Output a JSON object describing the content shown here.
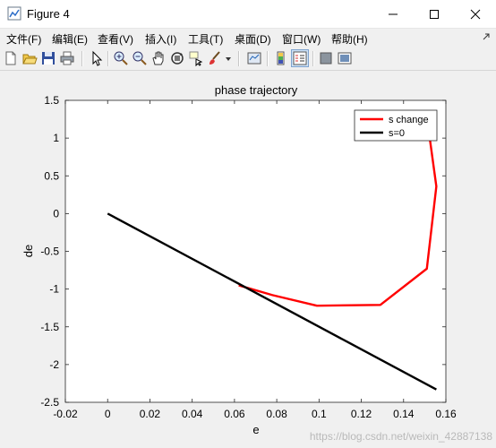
{
  "window": {
    "title": "Figure 4"
  },
  "menu": [
    "文件(F)",
    "编辑(E)",
    "查看(V)",
    "插入(I)",
    "工具(T)",
    "桌面(D)",
    "窗口(W)",
    "帮助(H)"
  ],
  "toolbar": {
    "icons": [
      "new-figure-icon",
      "open-file-icon",
      "save-icon",
      "print-icon",
      "edit-plot-arrow-icon",
      "zoom-in-icon",
      "zoom-out-icon",
      "pan-hand-icon",
      "rotate-3d-icon",
      "data-cursor-icon",
      "brush-icon",
      "brush-dropdown-icon",
      "link-plot-icon",
      "colorbar-icon",
      "legend-icon",
      "hide-plot-tools-icon",
      "show-plot-tools-icon"
    ]
  },
  "colors": {
    "s_change": "#ff0000",
    "s0": "#000000",
    "axes_bg": "#ffffff"
  },
  "chart_data": {
    "type": "line",
    "title": "phase trajectory",
    "xlabel": "e",
    "ylabel": "de",
    "xlim": [
      -0.02,
      0.16
    ],
    "ylim": [
      -2.5,
      1.5
    ],
    "xticks": [
      "-0.02",
      "0",
      "0.02",
      "0.04",
      "0.06",
      "0.08",
      "0.1",
      "0.12",
      "0.14",
      "0.16"
    ],
    "yticks": [
      "1.5",
      "1",
      "0.5",
      "0",
      "-0.5",
      "-1",
      "-1.5",
      "-2",
      "-2.5"
    ],
    "legend_position": "top-right",
    "grid": false,
    "series": [
      {
        "name": "s change",
        "x": [
          0.062,
          0.078,
          0.099,
          0.129,
          0.151,
          0.1555,
          0.151
        ],
        "y": [
          -0.95,
          -1.08,
          -1.22,
          -1.21,
          -0.73,
          0.36,
          1.28
        ]
      },
      {
        "name": "s=0",
        "x": [
          0.0,
          0.1555
        ],
        "y": [
          0.0,
          -2.33
        ]
      }
    ]
  },
  "watermark": "https://blog.csdn.net/weixin_42887138"
}
